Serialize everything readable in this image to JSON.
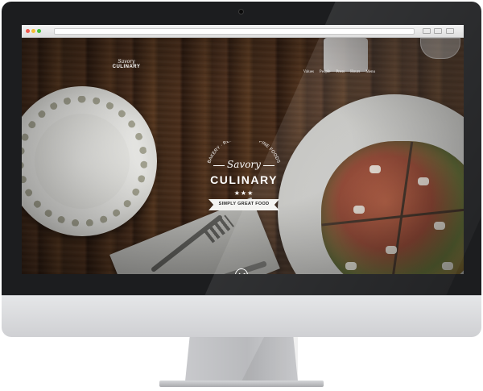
{
  "site": {
    "logo": {
      "script": "Savory",
      "name": "CULINARY"
    },
    "nav": [
      {
        "label": "Values"
      },
      {
        "label": "People"
      },
      {
        "label": "Press"
      },
      {
        "label": "Hours"
      },
      {
        "label": "Menu"
      }
    ],
    "hero": {
      "arc_text": "BAKERY · RESTARAUNT · FINE FOODS",
      "script": "Savory",
      "title": "CULINARY",
      "stars": "★★★",
      "tagline": "SIMPLY GREAT FOOD"
    }
  },
  "colors": {
    "monitor_bezel": "#1c1d1f",
    "monitor_chin": "#d9dadd",
    "browser_close": "#f0584d",
    "browser_minimize": "#f5be34",
    "browser_zoom": "#43c03b",
    "hero_text": "#ffffff"
  },
  "icons": {
    "scroll_down": "chevron-down-icon"
  }
}
